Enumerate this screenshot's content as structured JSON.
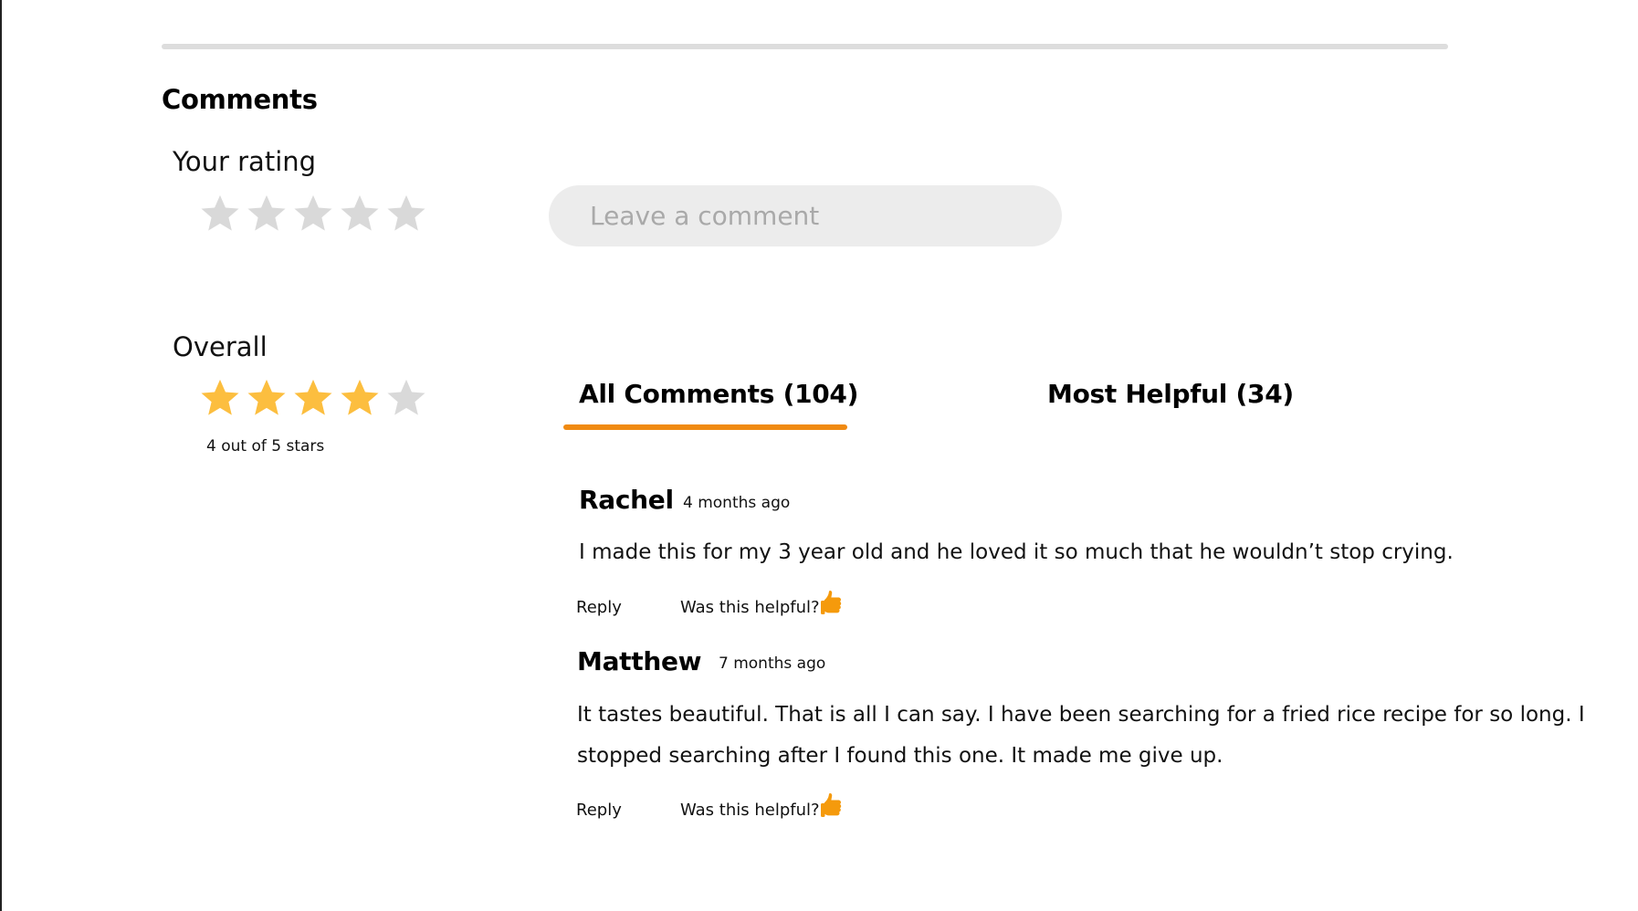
{
  "section_title": "Comments",
  "your_rating": {
    "label": "Your rating",
    "value": 0,
    "max": 5
  },
  "comment_input": {
    "placeholder": "Leave a comment",
    "value": ""
  },
  "overall": {
    "label": "Overall",
    "value": 4,
    "max": 5,
    "caption": "4 out of 5 stars"
  },
  "tabs": [
    {
      "label": "All Comments (104)",
      "active": true
    },
    {
      "label": "Most Helpful (34)",
      "active": false
    }
  ],
  "comments": [
    {
      "author": "Rachel",
      "time": "4 months ago",
      "text": "I made this for my 3 year old and he loved it so much that he wouldn’t stop crying.",
      "reply_label": "Reply",
      "helpful_label": "Was this helpful?",
      "helpful_icon": "thumbs-up-icon"
    },
    {
      "author": "Matthew",
      "time": "7 months ago",
      "text_lines": [
        "It tastes beautiful. That is all I can say. I have been searching for a fried rice recipe for so long. I",
        "stopped searching after I found this one. It made me give up."
      ],
      "reply_label": "Reply",
      "helpful_label": "Was this helpful?",
      "helpful_icon": "thumbs-up-icon"
    }
  ],
  "colors": {
    "accent": "#f08a12",
    "star_filled": "#fcbe3f",
    "star_empty": "#d9d9d9",
    "thumb": "#f59a0c",
    "input_bg": "#ececec",
    "divider": "#dddddd"
  }
}
